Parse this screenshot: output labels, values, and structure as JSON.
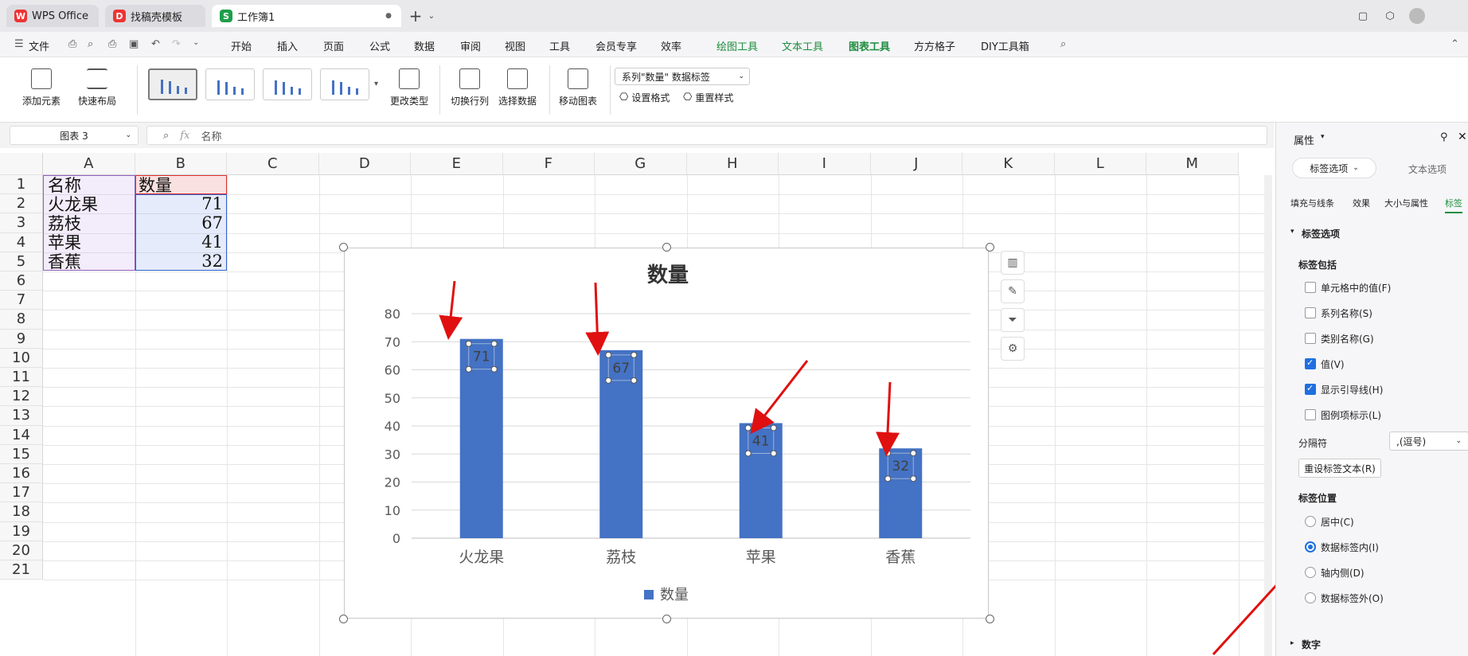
{
  "tabs": [
    {
      "label": "WPS Office"
    },
    {
      "label": "找稿壳模板"
    },
    {
      "label": "工作簿1"
    }
  ],
  "menu": {
    "file": "文件",
    "items": [
      "开始",
      "插入",
      "页面",
      "公式",
      "数据",
      "审阅",
      "视图",
      "工具",
      "会员专享",
      "效率",
      "绘图工具",
      "文本工具",
      "图表工具",
      "方方格子",
      "DIY工具箱"
    ]
  },
  "ribbon": {
    "add_element": "添加元素",
    "quick_layout": "快速布局",
    "change_type": "更改类型",
    "switch_row_col": "切换行列",
    "select_data": "选择数据",
    "move_chart": "移动图表",
    "element_select": "系列\"数量\" 数据标签",
    "set_format": "设置格式",
    "reset_style": "重置样式"
  },
  "formula_bar": {
    "name_box": "图表 3",
    "fx": "fx",
    "value": "名称"
  },
  "columns": [
    "A",
    "B",
    "C",
    "D",
    "E",
    "F",
    "G",
    "H",
    "I",
    "J",
    "K",
    "L",
    "M"
  ],
  "rows": [
    "1",
    "2",
    "3",
    "4",
    "5",
    "6",
    "7",
    "8",
    "9",
    "10",
    "11",
    "12",
    "13",
    "14",
    "15",
    "16",
    "17",
    "18",
    "19",
    "20",
    "21"
  ],
  "sheet": {
    "header": [
      "名称",
      "数量"
    ],
    "data": [
      [
        "火龙果",
        "71"
      ],
      [
        "荔枝",
        "67"
      ],
      [
        "苹果",
        "41"
      ],
      [
        "香蕉",
        "32"
      ]
    ]
  },
  "chart_data": {
    "type": "bar",
    "title": "数量",
    "categories": [
      "火龙果",
      "荔枝",
      "苹果",
      "香蕉"
    ],
    "series": [
      {
        "name": "数量",
        "values": [
          71,
          67,
          41,
          32
        ],
        "color": "#4472c4"
      }
    ],
    "ylim": [
      0,
      80
    ],
    "yticks": [
      0,
      10,
      20,
      30,
      40,
      50,
      60,
      70,
      80
    ],
    "grid": true,
    "legend": "bottom",
    "data_labels": "inside-end"
  },
  "panel": {
    "title": "属性",
    "tab_label_options": "标签选项",
    "tab_text_options": "文本选项",
    "subtabs": [
      "填充与线条",
      "效果",
      "大小与属性",
      "标签"
    ],
    "section": "标签选项",
    "label_contains": "标签包括",
    "checks": [
      {
        "label": "单元格中的值(F)",
        "checked": false
      },
      {
        "label": "系列名称(S)",
        "checked": false
      },
      {
        "label": "类别名称(G)",
        "checked": false
      },
      {
        "label": "值(V)",
        "checked": true
      },
      {
        "label": "显示引导线(H)",
        "checked": true
      },
      {
        "label": "图例项标示(L)",
        "checked": false
      }
    ],
    "separator_label": "分隔符",
    "separator_value": ",(逗号)",
    "reset_button": "重设标签文本(R)",
    "position_label": "标签位置",
    "positions": [
      {
        "label": "居中(C)",
        "selected": false
      },
      {
        "label": "数据标签内(I)",
        "selected": true
      },
      {
        "label": "轴内侧(D)",
        "selected": false
      },
      {
        "label": "数据标签外(O)",
        "selected": false
      }
    ],
    "number_section": "数字"
  },
  "colors": {
    "accent": "#1e8e3e",
    "bar": "#4472c4",
    "arrow": "#e01010",
    "radio": "#1f6fe0"
  }
}
